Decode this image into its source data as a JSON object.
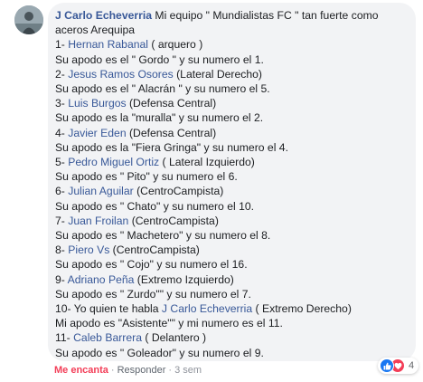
{
  "comment": {
    "author": "J Carlo Echeverria",
    "lines": [
      {
        "parts": [
          {
            "t": " Mi equipo \" Mundialistas FC \" tan fuerte como",
            "m": false
          }
        ]
      },
      {
        "parts": [
          {
            "t": "aceros Arequipa",
            "m": false
          }
        ]
      },
      {
        "parts": [
          {
            "t": "1- ",
            "m": false
          },
          {
            "t": "Hernan Rabanal",
            "m": true
          },
          {
            "t": " ( arquero )",
            "m": false
          }
        ]
      },
      {
        "parts": [
          {
            "t": "Su apodo es el \" Gordo \" y su numero el 1.",
            "m": false
          }
        ]
      },
      {
        "parts": [
          {
            "t": "2- ",
            "m": false
          },
          {
            "t": "Jesus Ramos Osores",
            "m": true
          },
          {
            "t": " (Lateral Derecho)",
            "m": false
          }
        ]
      },
      {
        "parts": [
          {
            "t": "Su apodo es el \" Alacrán \" y su numero el 5.",
            "m": false
          }
        ]
      },
      {
        "parts": [
          {
            "t": "3- ",
            "m": false
          },
          {
            "t": "Luis Burgos",
            "m": true
          },
          {
            "t": " (Defensa Central)",
            "m": false
          }
        ]
      },
      {
        "parts": [
          {
            "t": "Su apodo es la \"muralla\" y su numero el 2.",
            "m": false
          }
        ]
      },
      {
        "parts": [
          {
            "t": "4- ",
            "m": false
          },
          {
            "t": "Javier Eden",
            "m": true
          },
          {
            "t": " (Defensa Central)",
            "m": false
          }
        ]
      },
      {
        "parts": [
          {
            "t": "Su apodo es la \"Fiera Gringa\" y su numero el 4.",
            "m": false
          }
        ]
      },
      {
        "parts": [
          {
            "t": "5- ",
            "m": false
          },
          {
            "t": "Pedro Miguel Ortiz",
            "m": true
          },
          {
            "t": " ( Lateral Izquierdo)",
            "m": false
          }
        ]
      },
      {
        "parts": [
          {
            "t": "Su apodo es \" Pito\" y su numero el 6.",
            "m": false
          }
        ]
      },
      {
        "parts": [
          {
            "t": "6- ",
            "m": false
          },
          {
            "t": "Julian Aguilar",
            "m": true
          },
          {
            "t": " (CentroCampista)",
            "m": false
          }
        ]
      },
      {
        "parts": [
          {
            "t": "Su apodo es \" Chato\" y su numero el 10.",
            "m": false
          }
        ]
      },
      {
        "parts": [
          {
            "t": "7- ",
            "m": false
          },
          {
            "t": "Juan Froilan",
            "m": true
          },
          {
            "t": " (CentroCampista)",
            "m": false
          }
        ]
      },
      {
        "parts": [
          {
            "t": "Su apodo es \" Machetero\" y su numero el 8.",
            "m": false
          }
        ]
      },
      {
        "parts": [
          {
            "t": "8- ",
            "m": false
          },
          {
            "t": "Piero Vs",
            "m": true
          },
          {
            "t": " (CentroCampista)",
            "m": false
          }
        ]
      },
      {
        "parts": [
          {
            "t": "Su apodo es \" Cojo\" y su numero el 16.",
            "m": false
          }
        ]
      },
      {
        "parts": [
          {
            "t": "9- ",
            "m": false
          },
          {
            "t": "Adriano Peña",
            "m": true
          },
          {
            "t": " (Extremo Izquierdo)",
            "m": false
          }
        ]
      },
      {
        "parts": [
          {
            "t": "Su apodo es \" Zurdo\"\" y su numero el 7.",
            "m": false
          }
        ]
      },
      {
        "parts": [
          {
            "t": "10- Yo quien te habla ",
            "m": false
          },
          {
            "t": "J Carlo Echeverria",
            "m": true
          },
          {
            "t": " ( Extremo Derecho)",
            "m": false
          }
        ]
      },
      {
        "parts": [
          {
            "t": "Mi apodo es \"Asistente\"\" y mi numero es el 11.",
            "m": false
          }
        ]
      },
      {
        "parts": [
          {
            "t": "11- ",
            "m": false
          },
          {
            "t": "Caleb Barrera",
            "m": true
          },
          {
            "t": " ( Delantero )",
            "m": false
          }
        ]
      },
      {
        "parts": [
          {
            "t": "Su apodo es \" Goleador\" y su numero el 9.",
            "m": false
          }
        ]
      }
    ]
  },
  "actions": {
    "like_label": "Me encanta",
    "separator": "·",
    "reply_label": "Responder",
    "timestamp": "3 sem"
  },
  "reactions": {
    "count": "4",
    "icons": [
      "thumbs-up-icon",
      "heart-icon"
    ]
  },
  "colors": {
    "link": "#385898",
    "bubble_bg": "#f2f3f5",
    "like_active": "#f33e58",
    "like_reaction": "#1877f2",
    "love_reaction": "#f33e58",
    "text": "#1c1e21",
    "meta": "#90949c"
  }
}
